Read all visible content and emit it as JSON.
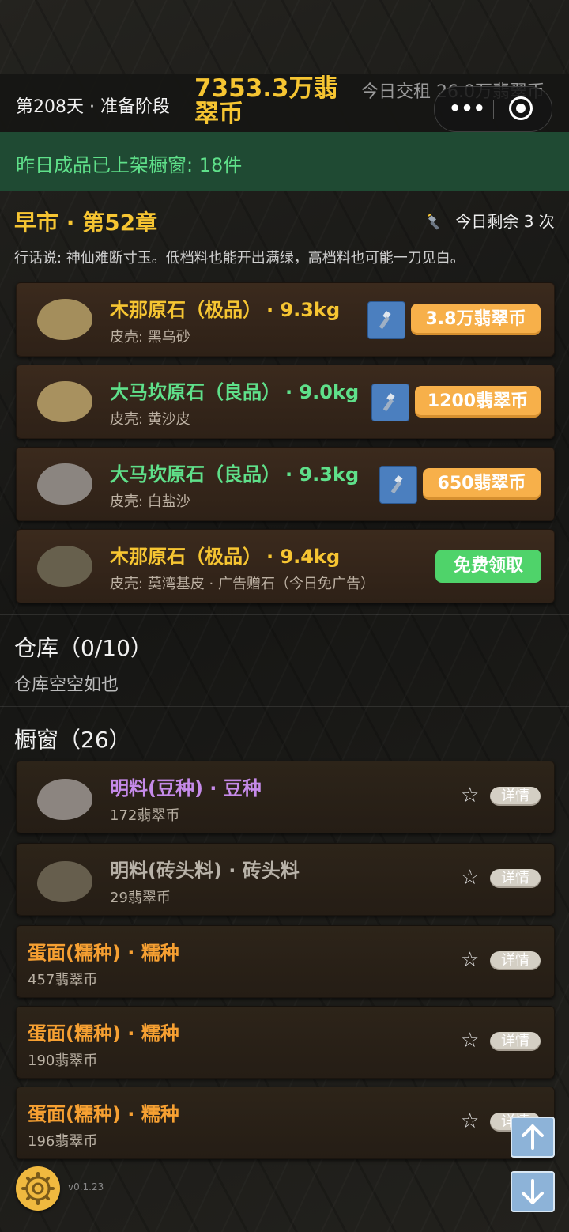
{
  "header": {
    "day_phase": "第208天 · 准备阶段",
    "money": "7353.3万翡翠币",
    "rent": "今日交租 26.0万翡翠币"
  },
  "notice": "昨日成品已上架橱窗: 18件",
  "market": {
    "title": "早市 · 第52章",
    "remaining": "今日剩余 3 次",
    "saying": "行话说: 神仙难断寸玉。低档料也能开出满绿，高档料也可能一刀见白。",
    "stones": [
      {
        "name": "木那原石（极品）",
        "weight": "· 9.3kg",
        "skin": "皮壳: 黑乌砂",
        "price": "3.8万翡翠币",
        "name_color": "#f6c532",
        "stone_color": "#a48e5c"
      },
      {
        "name": "大马坎原石（良品）",
        "weight": "· 9.0kg",
        "skin": "皮壳: 黄沙皮",
        "price": "1200翡翠币",
        "name_color": "#5fe08a",
        "stone_color": "#a8915f"
      },
      {
        "name": "大马坎原石（良品）",
        "weight": "· 9.3kg",
        "skin": "皮壳: 白盐沙",
        "price": "650翡翠币",
        "name_color": "#5fe08a",
        "stone_color": "#8b8580"
      },
      {
        "name": "木那原石（极品）",
        "weight": "· 9.4kg",
        "skin": "皮壳: 莫湾基皮 · 广告赠石（今日免广告）",
        "price": "免费领取",
        "name_color": "#f6c532",
        "stone_color": "#67604d"
      }
    ]
  },
  "warehouse": {
    "title": "仓库（0/10）",
    "empty": "仓库空空如也"
  },
  "showcase": {
    "title": "橱窗（26）",
    "detail_label": "详情",
    "items": [
      {
        "name": "明料(豆种) · 豆种",
        "price": "172翡翠币",
        "color": "#c58ae8",
        "stone_color": "#8c8580"
      },
      {
        "name": "明料(砖头料) · 砖头料",
        "price": "29翡翠币",
        "color": "#b8b2a8",
        "stone_color": "#665e4d"
      },
      {
        "name": "蛋面(糯种) · 糯种",
        "price": "457翡翠币",
        "color": "#f6a032"
      },
      {
        "name": "蛋面(糯种) · 糯种",
        "price": "190翡翠币",
        "color": "#f6a032"
      },
      {
        "name": "蛋面(糯种) · 糯种",
        "price": "196翡翠币",
        "color": "#f6a032"
      }
    ]
  },
  "footer": {
    "version": "v0.1.23"
  },
  "icons": {
    "flashlight": "flashlight-icon",
    "settings": "gear-icon",
    "up": "arrow-up-icon",
    "down": "arrow-down-icon",
    "star": "star-icon"
  }
}
